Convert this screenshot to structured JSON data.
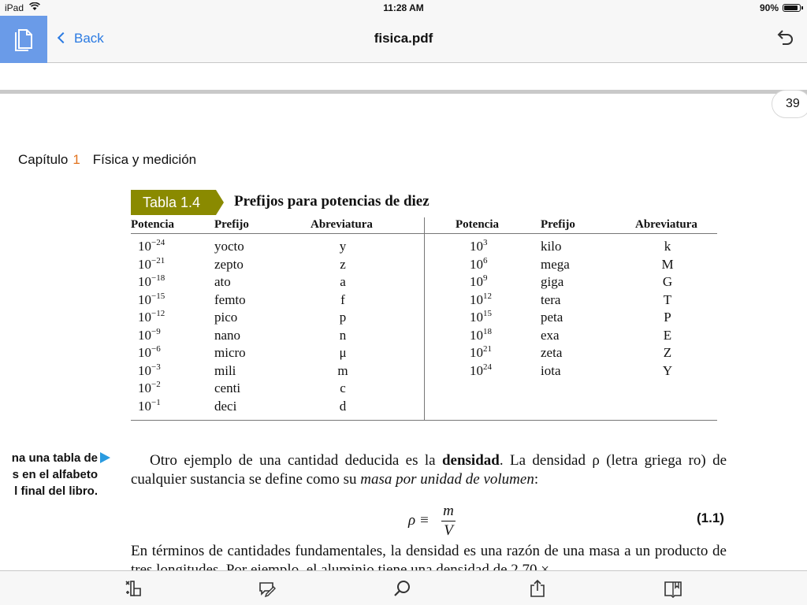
{
  "status_bar": {
    "device": "iPad",
    "time": "11:28 AM",
    "battery": "90%",
    "battery_level": 0.9
  },
  "nav": {
    "back_label": "Back",
    "title": "fisica.pdf",
    "icons": [
      "document-icon",
      "chevron-left-icon",
      "undo-icon"
    ]
  },
  "page": {
    "number": "39"
  },
  "chapter": {
    "label": "Capítulo",
    "number": "1",
    "title": "Física y medición",
    "number_color": "#e2731e"
  },
  "table": {
    "tag": "Tabla  1.4",
    "tag_color": "#8a8a00",
    "caption": "Prefijos para potencias de diez",
    "headers": {
      "potencia": "Potencia",
      "prefijo": "Prefijo",
      "abreviatura": "Abreviatura"
    },
    "left": [
      {
        "base": "10",
        "exp": "−24",
        "prefix": "yocto",
        "abbr": "y"
      },
      {
        "base": "10",
        "exp": "−21",
        "prefix": "zepto",
        "abbr": "z"
      },
      {
        "base": "10",
        "exp": "−18",
        "prefix": "ato",
        "abbr": "a"
      },
      {
        "base": "10",
        "exp": "−15",
        "prefix": "femto",
        "abbr": "f"
      },
      {
        "base": "10",
        "exp": "−12",
        "prefix": "pico",
        "abbr": "p"
      },
      {
        "base": "10",
        "exp": "−9",
        "prefix": "nano",
        "abbr": "n"
      },
      {
        "base": "10",
        "exp": "−6",
        "prefix": "micro",
        "abbr": "μ"
      },
      {
        "base": "10",
        "exp": "−3",
        "prefix": "mili",
        "abbr": "m"
      },
      {
        "base": "10",
        "exp": "−2",
        "prefix": "centi",
        "abbr": "c"
      },
      {
        "base": "10",
        "exp": "−1",
        "prefix": "deci",
        "abbr": "d"
      }
    ],
    "right": [
      {
        "base": "10",
        "exp": "3",
        "prefix": "kilo",
        "abbr": "k"
      },
      {
        "base": "10",
        "exp": "6",
        "prefix": "mega",
        "abbr": "M"
      },
      {
        "base": "10",
        "exp": "9",
        "prefix": "giga",
        "abbr": "G"
      },
      {
        "base": "10",
        "exp": "12",
        "prefix": "tera",
        "abbr": "T"
      },
      {
        "base": "10",
        "exp": "15",
        "prefix": "peta",
        "abbr": "P"
      },
      {
        "base": "10",
        "exp": "18",
        "prefix": "exa",
        "abbr": "E"
      },
      {
        "base": "10",
        "exp": "21",
        "prefix": "zeta",
        "abbr": "Z"
      },
      {
        "base": "10",
        "exp": "24",
        "prefix": "iota",
        "abbr": "Y"
      }
    ]
  },
  "margin_note": {
    "lines": [
      "na una tabla de",
      "s en el alfabeto",
      "l final del libro."
    ],
    "arrow_color": "#2a9be0"
  },
  "body": {
    "p1_a": "Otro ejemplo de una cantidad deducida es la ",
    "p1_bold": "densidad",
    "p1_b": ". La densidad ρ (letra griega ro) de cualquier sustancia se define como su ",
    "p1_italic": "masa por unidad de volumen",
    "p1_c": ":",
    "eq_lhs": "ρ ≡",
    "eq_num": "m",
    "eq_den": "V",
    "eq_label": "(1.1)",
    "p2": "En términos de cantidades fundamentales, la densidad es una razón de una masa a un producto de tres longitudes. Por ejemplo, el aluminio tiene una densidad de 2.70 ×"
  },
  "toolbar": {
    "icons": [
      "thumbnails-icon",
      "annotate-icon",
      "search-icon",
      "share-icon",
      "bookmarks-icon"
    ]
  }
}
